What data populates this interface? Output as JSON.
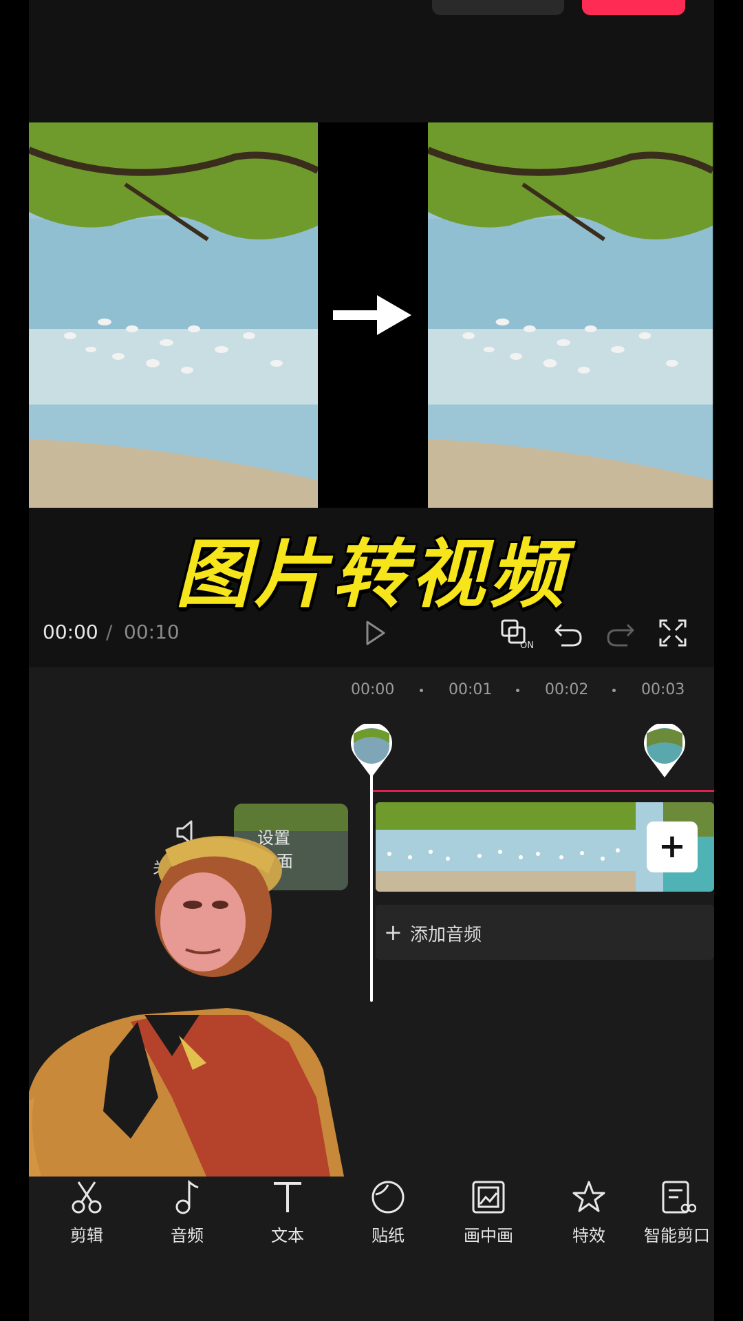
{
  "headline": "图片转视频",
  "playback": {
    "current_time": "00:00",
    "separator": "/",
    "total_time": "00:10",
    "controls": [
      "play-icon",
      "keyframe-on-icon",
      "undo-icon",
      "redo-icon",
      "fullscreen-icon"
    ],
    "keyframe_badge": "ON"
  },
  "ruler": {
    "ticks": [
      "00:00",
      "00:01",
      "00:02",
      "00:03"
    ]
  },
  "track": {
    "mute_label": "关",
    "cover_line1": "设置",
    "cover_line2": "面",
    "add_clip": "+",
    "add_audio_plus": "+",
    "add_audio_label": "添加音频"
  },
  "toolbar": {
    "items": [
      {
        "label": "剪辑",
        "icon": "scissors-icon"
      },
      {
        "label": "音频",
        "icon": "music-note-icon"
      },
      {
        "label": "文本",
        "icon": "text-icon"
      },
      {
        "label": "贴纸",
        "icon": "sticker-icon"
      },
      {
        "label": "画中画",
        "icon": "picture-in-picture-icon"
      },
      {
        "label": "特效",
        "icon": "effects-star-icon"
      },
      {
        "label": "智能剪口",
        "icon": "smart-cut-icon"
      }
    ]
  },
  "colors": {
    "accent_red": "#fe2c55",
    "headline_yellow": "#f7e51b",
    "track_red": "#e0214f"
  }
}
